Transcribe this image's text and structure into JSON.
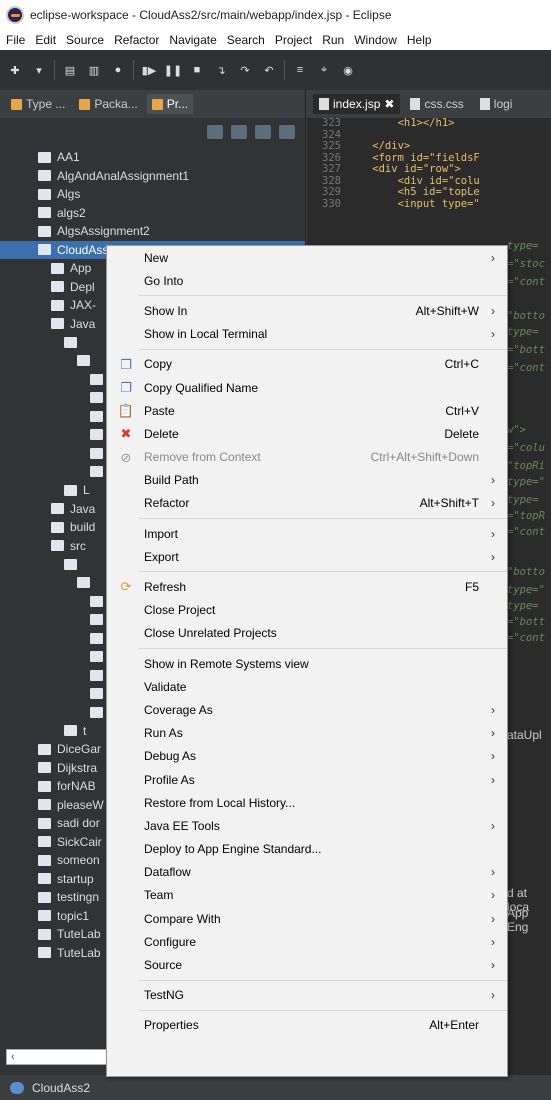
{
  "window": {
    "title": "eclipse-workspace - CloudAss2/src/main/webapp/index.jsp - Eclipse"
  },
  "menubar": [
    "File",
    "Edit",
    "Source",
    "Refactor",
    "Navigate",
    "Search",
    "Project",
    "Run",
    "Window",
    "Help"
  ],
  "explorer": {
    "tabs": [
      {
        "label": "Type ..."
      },
      {
        "label": "Packa..."
      },
      {
        "label": "Pr..."
      }
    ],
    "items": [
      {
        "label": "AA1"
      },
      {
        "label": "AlgAndAnalAssignment1"
      },
      {
        "label": "Algs"
      },
      {
        "label": "algs2"
      },
      {
        "label": "AlgsAssignment2"
      },
      {
        "label": "CloudAss2"
      },
      {
        "label": "App"
      },
      {
        "label": "Depl"
      },
      {
        "label": "JAX-"
      },
      {
        "label": "Java"
      },
      {
        "label": ""
      },
      {
        "label": ""
      },
      {
        "label": ""
      },
      {
        "label": ""
      },
      {
        "label": ""
      },
      {
        "label": ""
      },
      {
        "label": ""
      },
      {
        "label": ""
      },
      {
        "label": "L"
      },
      {
        "label": "Java"
      },
      {
        "label": "build"
      },
      {
        "label": "src"
      },
      {
        "label": ""
      },
      {
        "label": ""
      },
      {
        "label": ""
      },
      {
        "label": ""
      },
      {
        "label": ""
      },
      {
        "label": ""
      },
      {
        "label": ""
      },
      {
        "label": ""
      },
      {
        "label": ""
      },
      {
        "label": "t"
      },
      {
        "label": "DiceGar"
      },
      {
        "label": "Dijkstra"
      },
      {
        "label": "forNAB"
      },
      {
        "label": "pleaseW"
      },
      {
        "label": "sadi dor"
      },
      {
        "label": "SickCair"
      },
      {
        "label": "someon"
      },
      {
        "label": "startup"
      },
      {
        "label": "testingn"
      },
      {
        "label": "topic1"
      },
      {
        "label": "TuteLab"
      },
      {
        "label": "TuteLab"
      }
    ]
  },
  "editor": {
    "tabs": [
      {
        "label": "index.jsp"
      },
      {
        "label": "css.css"
      },
      {
        "label": "logi"
      }
    ],
    "lines": [
      {
        "num": "323",
        "text": "        <h1></h1>"
      },
      {
        "num": "324",
        "text": ""
      },
      {
        "num": "325",
        "text": "    </div>"
      },
      {
        "num": "326",
        "text": "    <form id=\"fieldsF"
      },
      {
        "num": "327",
        "text": "    <div id=\"row\">"
      },
      {
        "num": "328",
        "text": "        <div id=\"colu"
      },
      {
        "num": "329",
        "text": "        <h5 id=\"topLe"
      },
      {
        "num": "330",
        "text": "        <input type=\""
      }
    ],
    "right_fragments": [
      "type=",
      "=\"stoc",
      "=\"cont",
      "\"botto",
      "type=",
      "=\"bott",
      "=\"cont",
      "w\">",
      "=\"colu",
      "\"topRi",
      "type=\"",
      "type=",
      "=\"topR",
      "=\"cont",
      "\"botto",
      "type=\"",
      "type=",
      "=\"bott",
      "=\"cont",
      "ataUpl",
      "d at loca",
      "App Eng"
    ]
  },
  "context_menu": {
    "items": [
      {
        "label": "New",
        "arrow": true
      },
      {
        "label": "Go Into"
      },
      {
        "sep": true
      },
      {
        "label": "Show In",
        "accel": "Alt+Shift+W",
        "arrow": true
      },
      {
        "label": "Show in Local Terminal",
        "arrow": true
      },
      {
        "sep": true
      },
      {
        "label": "Copy",
        "accel": "Ctrl+C",
        "icon": "copy-icon"
      },
      {
        "label": "Copy Qualified Name",
        "icon": "copy-qualified-icon"
      },
      {
        "label": "Paste",
        "accel": "Ctrl+V",
        "icon": "paste-icon"
      },
      {
        "label": "Delete",
        "accel": "Delete",
        "icon": "delete-icon"
      },
      {
        "label": "Remove from Context",
        "accel": "Ctrl+Alt+Shift+Down",
        "disabled": true,
        "icon": "remove-context-icon"
      },
      {
        "label": "Build Path",
        "arrow": true
      },
      {
        "label": "Refactor",
        "accel": "Alt+Shift+T",
        "arrow": true
      },
      {
        "sep": true
      },
      {
        "label": "Import",
        "arrow": true
      },
      {
        "label": "Export",
        "arrow": true
      },
      {
        "sep": true
      },
      {
        "label": "Refresh",
        "accel": "F5",
        "icon": "refresh-icon"
      },
      {
        "label": "Close Project"
      },
      {
        "label": "Close Unrelated Projects"
      },
      {
        "sep": true
      },
      {
        "label": "Show in Remote Systems view"
      },
      {
        "label": "Validate"
      },
      {
        "label": "Coverage As",
        "arrow": true
      },
      {
        "label": "Run As",
        "arrow": true
      },
      {
        "label": "Debug As",
        "arrow": true
      },
      {
        "label": "Profile As",
        "arrow": true
      },
      {
        "label": "Restore from Local History..."
      },
      {
        "label": "Java EE Tools",
        "arrow": true
      },
      {
        "label": "Deploy to App Engine Standard..."
      },
      {
        "label": "Dataflow",
        "arrow": true
      },
      {
        "label": "Team",
        "arrow": true
      },
      {
        "label": "Compare With",
        "arrow": true
      },
      {
        "label": "Configure",
        "arrow": true
      },
      {
        "label": "Source",
        "arrow": true
      },
      {
        "sep": true
      },
      {
        "label": "TestNG",
        "arrow": true
      },
      {
        "sep": true
      },
      {
        "label": "Properties",
        "accel": "Alt+Enter"
      }
    ]
  },
  "statusbar": {
    "text": "CloudAss2"
  },
  "colors": {
    "selection": "#3c6fad",
    "menu_bg": "#f2f2f2",
    "dark_bg": "#313335"
  }
}
